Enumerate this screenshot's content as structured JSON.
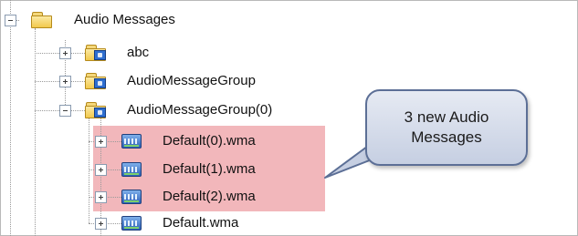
{
  "tree": {
    "root": {
      "label": "Audio Messages",
      "icon": "folder-icon",
      "expanded": true
    },
    "groups": [
      {
        "label": "abc",
        "icon": "folder-icon",
        "expanded": false
      },
      {
        "label": "AudioMessageGroup",
        "icon": "folder-icon",
        "expanded": false
      },
      {
        "label": "AudioMessageGroup(0)",
        "icon": "folder-icon",
        "expanded": true,
        "children": [
          {
            "label": "Default(0).wma",
            "icon": "wma-icon",
            "highlighted": true
          },
          {
            "label": "Default(1).wma",
            "icon": "wma-icon",
            "highlighted": true
          },
          {
            "label": "Default(2).wma",
            "icon": "wma-icon",
            "highlighted": true
          },
          {
            "label": "Default.wma",
            "icon": "wma-icon",
            "highlighted": false
          }
        ]
      }
    ]
  },
  "callout": {
    "text": "3 new Audio\nMessages"
  },
  "colors": {
    "highlight": "#f2b7bb",
    "callout_border": "#5c6f96",
    "callout_fill": "#d5dbe9"
  }
}
